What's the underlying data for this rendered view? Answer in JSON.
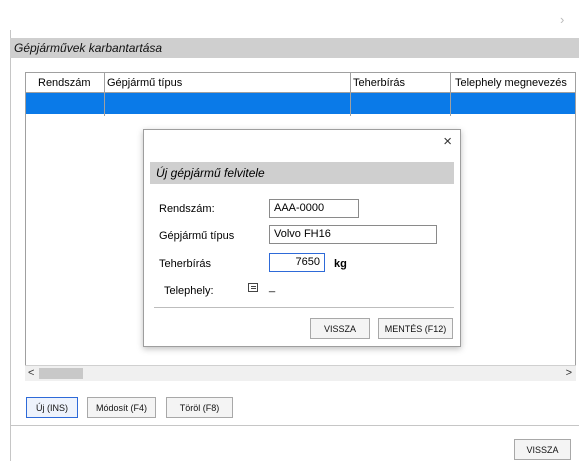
{
  "window": {
    "close_glyph": "›"
  },
  "section": {
    "title": "Gépjárművek karbantartása"
  },
  "grid": {
    "columns": [
      "Rendszám",
      "Gépjármű típus",
      "Teherbírás",
      "Telephely megnevezés"
    ]
  },
  "scrollbar": {
    "left_arrow": "<",
    "right_arrow": ">"
  },
  "toolbar": {
    "new_label": "Új (INS)",
    "edit_label": "Módosít (F4)",
    "delete_label": "Töröl (F8)"
  },
  "footer": {
    "back_label": "VISSZA"
  },
  "dialog": {
    "close_glyph": "×",
    "title": "Új gépjármű felvitele",
    "plate_label": "Rendszám:",
    "plate_value": "AAA-0000",
    "type_label": "Gépjármű típus",
    "type_value": "Volvo FH16",
    "capacity_label": "Teherbírás",
    "capacity_value": "7650",
    "capacity_unit": "kg",
    "site_label": "Telephely:",
    "site_value": "_",
    "back_label": "VISSZA",
    "save_label": "MENTÉS (F12)"
  },
  "colors": {
    "selection": "#0a7ae8",
    "header_band": "#cfcfcf",
    "focus": "#2e6ad8"
  }
}
